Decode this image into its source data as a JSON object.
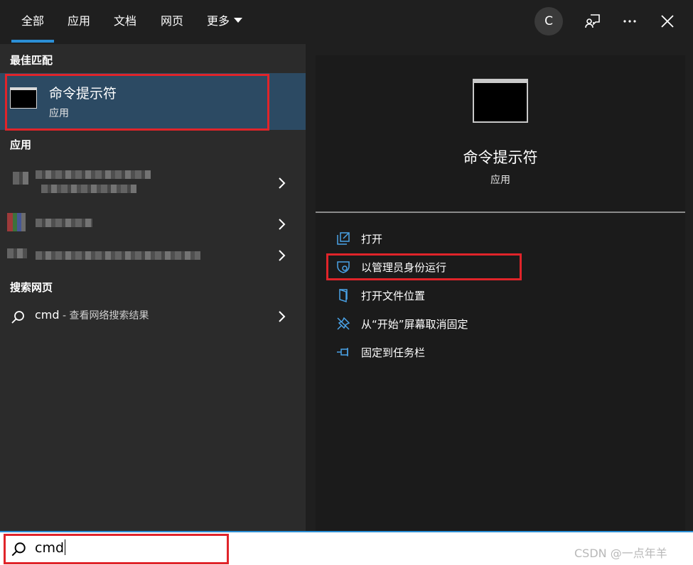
{
  "tabs": [
    {
      "label": "全部"
    },
    {
      "label": "应用"
    },
    {
      "label": "文档"
    },
    {
      "label": "网页"
    },
    {
      "label": "更多"
    }
  ],
  "avatar": {
    "letter": "C"
  },
  "left": {
    "best_match_heading": "最佳匹配",
    "best_match": {
      "title": "命令提示符",
      "subtitle": "应用"
    },
    "apps_heading": "应用",
    "web_heading": "搜索网页",
    "web_result": {
      "query": "cmd",
      "hint": " - 查看网络搜索结果"
    }
  },
  "right": {
    "title": "命令提示符",
    "subtitle": "应用",
    "actions": [
      {
        "label": "打开",
        "icon": "open-icon"
      },
      {
        "label": "以管理员身份运行",
        "icon": "shield-icon"
      },
      {
        "label": "打开文件位置",
        "icon": "folder-icon"
      },
      {
        "label": "从“开始”屏幕取消固定",
        "icon": "unpin-icon"
      },
      {
        "label": "固定到任务栏",
        "icon": "pin-icon"
      }
    ]
  },
  "search": {
    "value": "cmd"
  },
  "watermark": "CSDN @一点年羊",
  "colors": {
    "accent": "#2b8fd6",
    "highlight_box": "#e0242a",
    "selected_row": "#2c4a63"
  }
}
